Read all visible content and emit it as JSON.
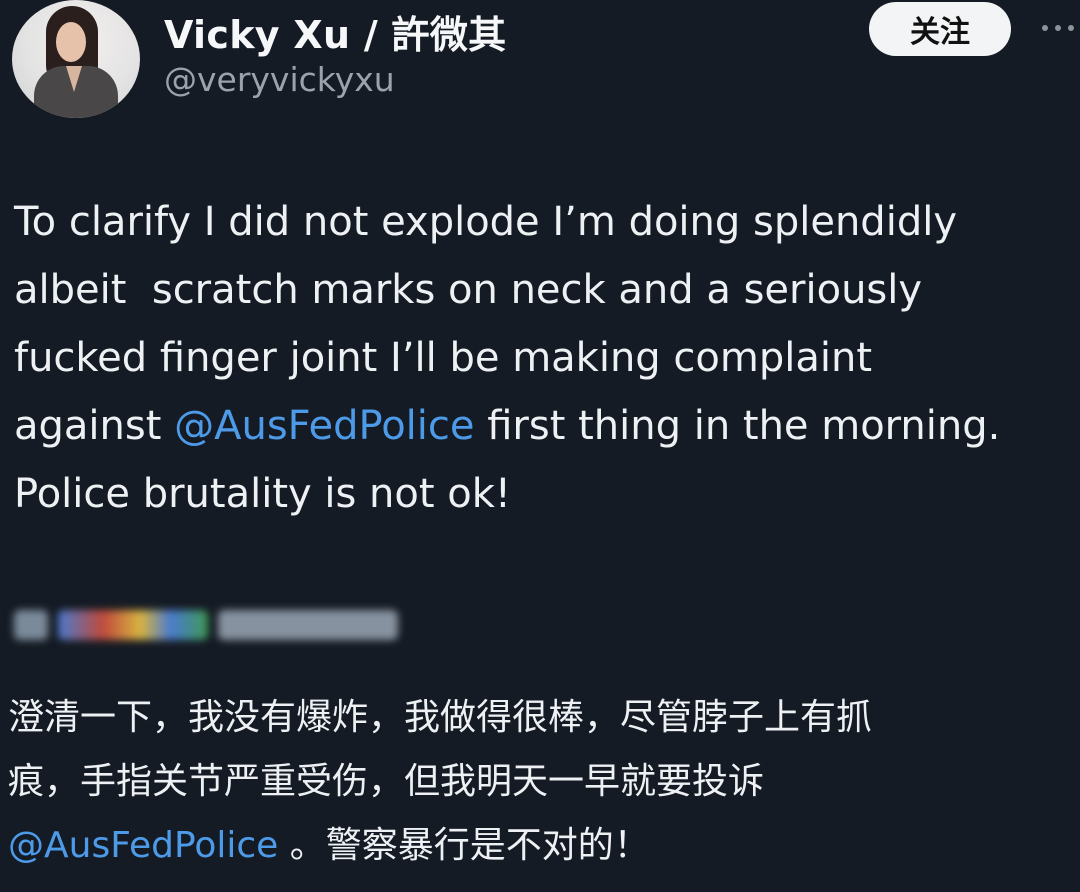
{
  "tweet": {
    "author_name": "Vicky Xu / 許微其",
    "author_handle": "@veryvickyxu",
    "follow_label": "关注",
    "text_line1": "To clarify I did not explode I’m doing splendidly",
    "text_line2": "albeit  scratch marks on neck and a seriously",
    "text_line3": "fucked finger joint I’ll be making complaint",
    "text_line4_pre": "against ",
    "text_line4_mention": "@AusFedPolice",
    "text_line4_post": " first thing in the morning.",
    "text_line5": "Police brutality is not ok!"
  },
  "translation": {
    "line1": "澄清一下，我没有爆炸，我做得很棒，尽管脖子上有抓",
    "line2": "痕，手指关节严重受伤，但我明天一早就要投诉",
    "line3_mention": "@AusFedPolice",
    "line3_post": " 。警察暴行是不对的！"
  },
  "colors": {
    "background": "#151b24",
    "mention": "#4d9be8",
    "handle": "#9aa3ad"
  },
  "icons": {
    "more": "more-horizontal-icon"
  }
}
